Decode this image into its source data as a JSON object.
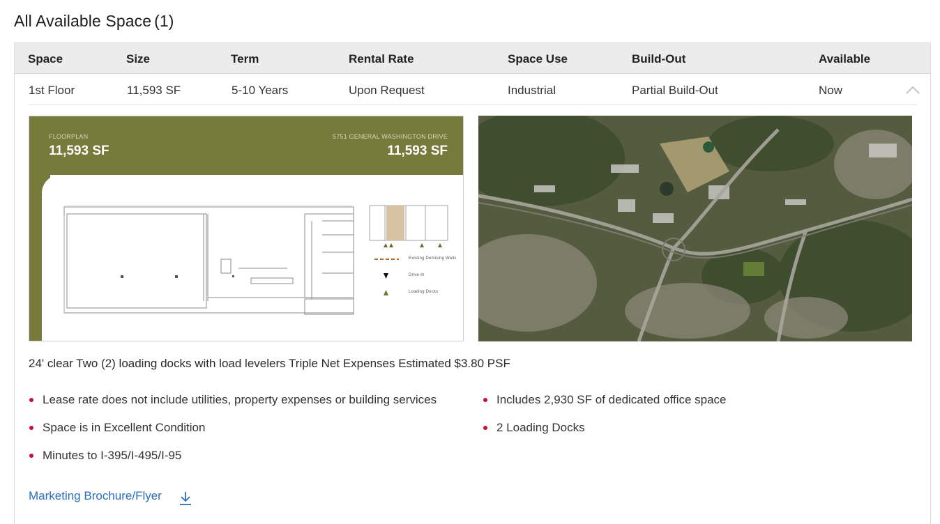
{
  "page": {
    "title": "All Available Space",
    "count": "(1)"
  },
  "table": {
    "headers": [
      "Space",
      "Size",
      "Term",
      "Rental Rate",
      "Space Use",
      "Build-Out",
      "Available"
    ],
    "row": [
      "1st Floor",
      "11,593 SF",
      "5-10 Years",
      "Upon Request",
      "Industrial",
      "Partial Build-Out",
      "Now"
    ]
  },
  "floorplan": {
    "label": "FLOORPLAN",
    "size_left": "11,593 SF",
    "address": "5751 GENERAL WASHINGTON DRIVE",
    "size_right": "11,593 SF",
    "legend": [
      "Existing Demising Walls",
      "Drive-In",
      "Loading Docks"
    ],
    "band_color": "#767a3a"
  },
  "aerial": {
    "image": "aerial-map-photo"
  },
  "description": "24' clear Two (2) loading docks with load levelers Triple Net Expenses Estimated $3.80 PSF",
  "features": {
    "left": [
      "Lease rate does not include utilities, property expenses or building services",
      "Space is in Excellent Condition",
      "Minutes to I-395/I-495/I-95"
    ],
    "right": [
      "Includes 2,930 SF of dedicated office space",
      "2 Loading Docks"
    ]
  },
  "links": {
    "brochure": "Marketing Brochure/Flyer"
  },
  "colors": {
    "accent": "#c8102e",
    "link": "#2a6ebb",
    "header_bg": "#ececec"
  },
  "icons": {
    "collapse": "chevron-up-icon",
    "download": "download-icon",
    "bullet": "bullet-dot-icon"
  }
}
